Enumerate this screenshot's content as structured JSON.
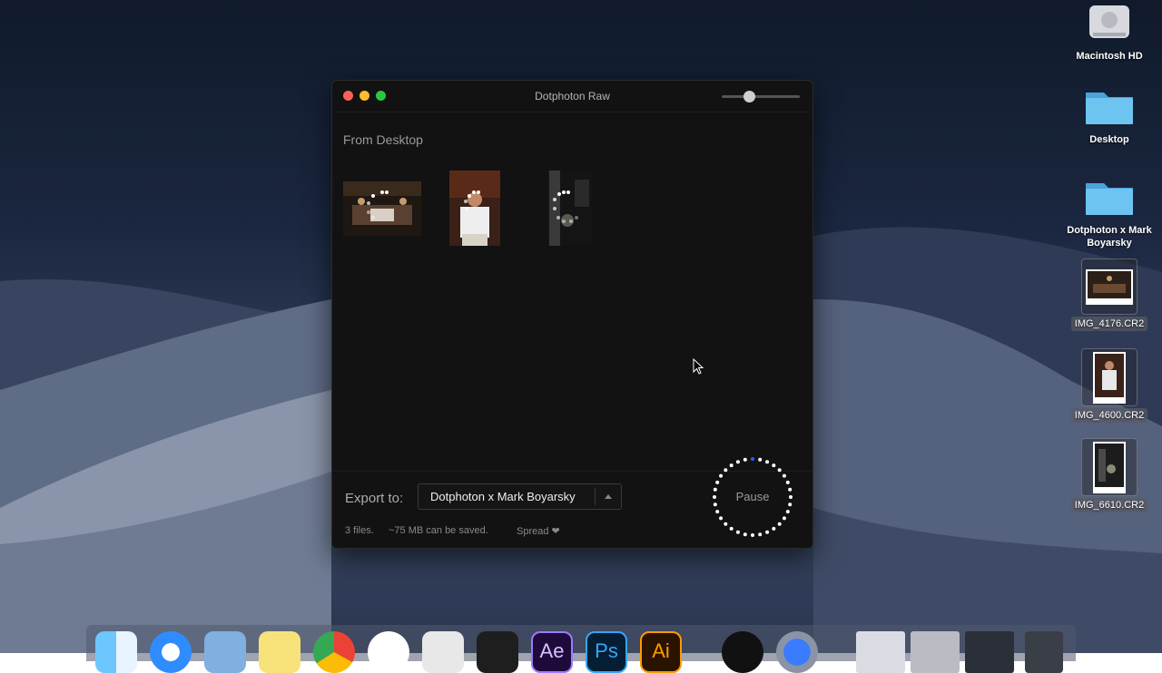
{
  "desktop": {
    "icons": [
      {
        "label": "Macintosh HD"
      },
      {
        "label": "Desktop"
      },
      {
        "label": "Dotphoton x Mark Boyarsky"
      },
      {
        "label": "IMG_4176.CR2"
      },
      {
        "label": "IMG_4600.CR2"
      },
      {
        "label": "IMG_6610.CR2"
      }
    ]
  },
  "window": {
    "title": "Dotphoton Raw",
    "section_title": "From Desktop",
    "thumbnails": [
      "IMG_4176.CR2",
      "IMG_4600.CR2",
      "IMG_6610.CR2"
    ],
    "export_label": "Export to:",
    "export_target": "Dotphoton x Mark Boyarsky",
    "files_count": "3 files.",
    "savings": "~75 MB can be saved.",
    "spread": "Spread ❤",
    "pause_label": "Pause"
  },
  "colors": {
    "close": "#ff5f57",
    "minimize": "#febc2e",
    "zoom": "#28c840",
    "window_bg": "#121212",
    "progress_accent": "#2c5bff"
  },
  "dock": {
    "icons": [
      "finder-icon",
      "safari-icon",
      "preview-icon",
      "notes-icon",
      "chrome-icon",
      "app-icon",
      "sketch-icon",
      "figma-icon",
      "after-effects-icon",
      "photoshop-icon",
      "illustrator-icon",
      "dotphoton-icon",
      "app-blue-icon",
      "window-thumb",
      "window-thumb",
      "window-thumb",
      "trash-icon"
    ],
    "text": {
      "ae": "Ae",
      "ps": "Ps",
      "ai": "Ai"
    }
  }
}
